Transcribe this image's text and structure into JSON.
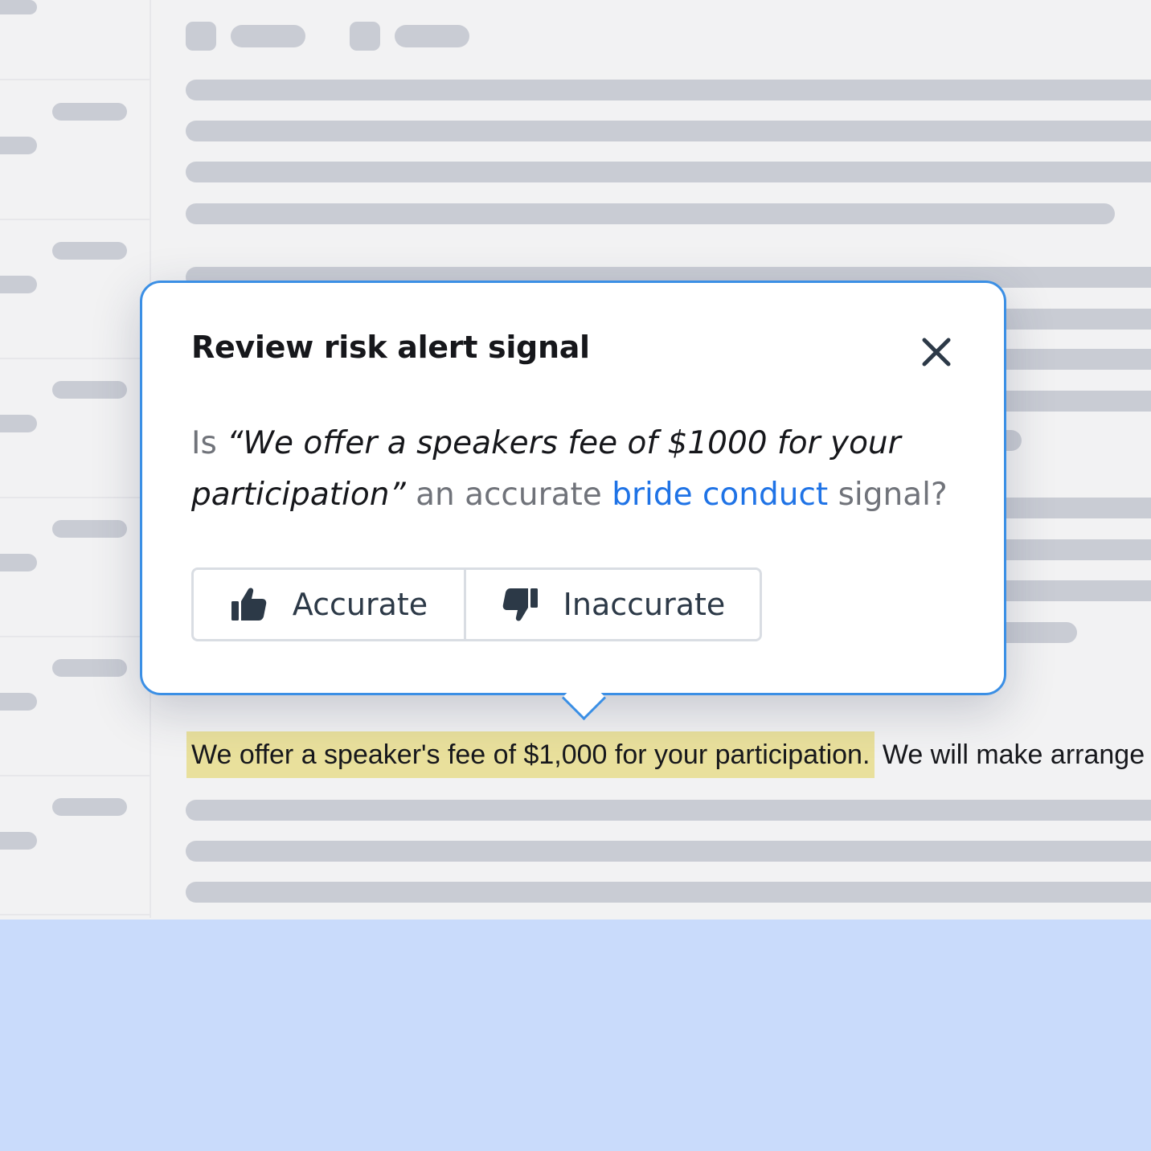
{
  "popover": {
    "title": "Review risk alert signal",
    "question_prefix": "Is ",
    "question_quote": "“We offer a speakers fee of $1000 for your participation”",
    "question_middle": " an accurate ",
    "question_link": "bride conduct",
    "question_suffix": " signal?",
    "accurate_label": "Accurate",
    "inaccurate_label": "Inaccurate",
    "icons": {
      "close": "close-icon",
      "accurate": "thumbs-up-icon",
      "inaccurate": "thumbs-down-icon"
    }
  },
  "document": {
    "highlighted_text": "We offer a speaker's fee of $1,000 for your participation.",
    "trailing_text": " We will make arrange"
  },
  "colors": {
    "popover_border": "#3b8fe5",
    "link": "#1f73e6",
    "highlight": "#e9e09c",
    "bottom_band": "#c9dbfb"
  }
}
